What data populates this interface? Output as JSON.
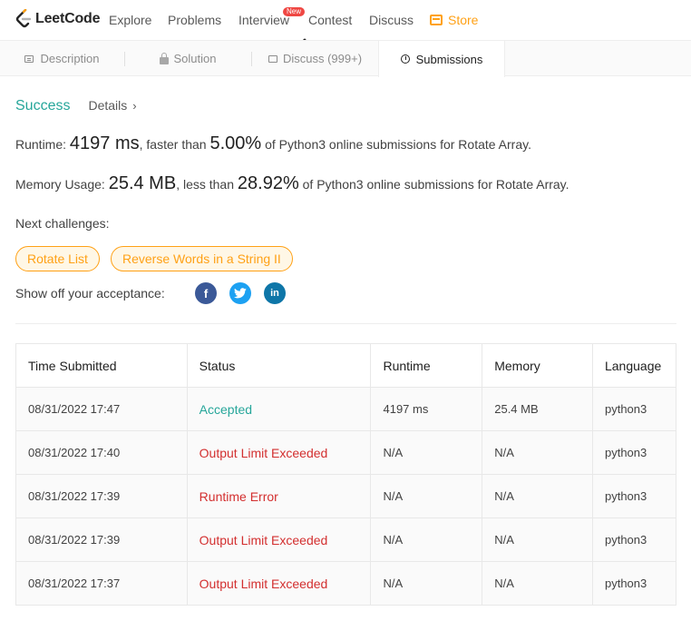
{
  "brand": {
    "name": "LeetCode",
    "logo_icon": "leetcode-logo-icon"
  },
  "nav": {
    "items": [
      {
        "label": "Explore"
      },
      {
        "label": "Problems"
      },
      {
        "label": "Interview"
      },
      {
        "label": "Contest"
      },
      {
        "label": "Discuss"
      }
    ],
    "new_badge": "New",
    "store_label": "Store",
    "store_icon": "store-icon",
    "store_color": "#ffa116"
  },
  "tabs": [
    {
      "label": "Description",
      "icon": "description-icon"
    },
    {
      "label": "Solution",
      "icon": "lock-icon"
    },
    {
      "label": "Discuss (999+)",
      "icon": "chat-icon"
    },
    {
      "label": "Submissions",
      "icon": "clock-icon",
      "active": true
    }
  ],
  "result": {
    "status": "Success",
    "details_label": "Details",
    "details_chevron": "›",
    "runtime_label": "Runtime:",
    "runtime_value": "4197 ms",
    "runtime_mid": ", faster than",
    "runtime_pct": "5.00%",
    "runtime_tail": "of Python3 online submissions for Rotate Array.",
    "memory_label": "Memory Usage:",
    "memory_value": "25.4 MB",
    "memory_mid": ", less than",
    "memory_pct": "28.92%",
    "memory_tail": "of Python3 online submissions for Rotate Array.",
    "success_color": "#26a69a"
  },
  "next_challenges": {
    "label": "Next challenges:",
    "items": [
      "Rotate List",
      "Reverse Words in a String II"
    ]
  },
  "share": {
    "label": "Show off your acceptance:",
    "icons": [
      "facebook-icon",
      "twitter-icon",
      "linkedin-icon"
    ],
    "facebook_glyph": "f",
    "linkedin_glyph": "in"
  },
  "submissions": {
    "headers": [
      "Time Submitted",
      "Status",
      "Runtime",
      "Memory",
      "Language"
    ],
    "rows": [
      {
        "time": "08/31/2022 17:47",
        "status": "Accepted",
        "runtime": "4197 ms",
        "memory": "25.4 MB",
        "language": "python3"
      },
      {
        "time": "08/31/2022 17:40",
        "status": "Output Limit Exceeded",
        "runtime": "N/A",
        "memory": "N/A",
        "language": "python3"
      },
      {
        "time": "08/31/2022 17:39",
        "status": "Runtime Error",
        "runtime": "N/A",
        "memory": "N/A",
        "language": "python3"
      },
      {
        "time": "08/31/2022 17:39",
        "status": "Output Limit Exceeded",
        "runtime": "N/A",
        "memory": "N/A",
        "language": "python3"
      },
      {
        "time": "08/31/2022 17:37",
        "status": "Output Limit Exceeded",
        "runtime": "N/A",
        "memory": "N/A",
        "language": "python3"
      }
    ],
    "accepted_color": "#26a69a",
    "error_color": "#d32f2f"
  }
}
